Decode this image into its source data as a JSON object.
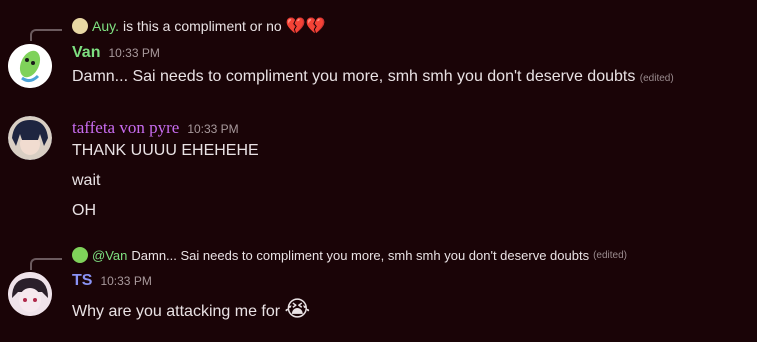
{
  "messages": [
    {
      "reply": {
        "author": "Auy.",
        "text": "is this a compliment or no",
        "emoji": "💔💔"
      },
      "author": "Van",
      "author_color": "#7ee081",
      "time": "10:33 PM",
      "lines": [
        "Damn... Sai needs to compliment you more, smh smh you don't deserve doubts"
      ],
      "edited": "(edited)",
      "avatar_icon": "green-cat-avatar"
    },
    {
      "author": "taffeta von pyre",
      "author_color": "#c86cf0",
      "time": "10:33 PM",
      "lines": [
        "THANK UUUU EHEHEHE",
        "wait",
        "OH"
      ],
      "avatar_icon": "dark-hair-avatar"
    },
    {
      "reply": {
        "author": "@Van",
        "text": "Damn... Sai needs to compliment you more, smh smh you don't deserve doubts",
        "edited": "(edited)"
      },
      "author": "TS",
      "author_color": "#8a93f5",
      "time": "10:33 PM",
      "lines": [
        "Why are you attacking me for"
      ],
      "emoji": "😭",
      "avatar_icon": "pale-face-avatar"
    }
  ]
}
